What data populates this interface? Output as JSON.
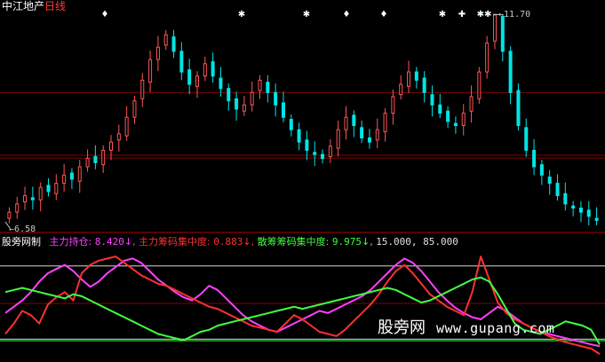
{
  "header": {
    "title": "中江地产",
    "period": "日线"
  },
  "price_panel": {
    "high_label": "11.70",
    "low_label": "6.58",
    "marker_glyphs": [
      "♦",
      "✱",
      "✱",
      "♦",
      "♦",
      "✱",
      "✚",
      "✱✱"
    ]
  },
  "indicator": {
    "name": "股旁网制",
    "items": [
      {
        "label": "主力持仓:",
        "value": "8.420",
        "arrow": "↓",
        "color": "#ff40ff"
      },
      {
        "label": "主力筹码集中度:",
        "value": "0.883",
        "arrow": "↓",
        "color": "#ff3030"
      },
      {
        "label": "散筹筹码集中度:",
        "value": "9.975",
        "arrow": "↓",
        "color": "#40ff40"
      }
    ],
    "levels": "15.000, 85.000"
  },
  "watermark": {
    "text": "股旁网",
    "url": "www.gupang.com"
  },
  "colors": {
    "background": "#000000",
    "up_candle": "#ff5555",
    "down_candle": "#00e5e5",
    "grid": "#8b0000",
    "magenta": "#ff40ff",
    "red": "#ff3030",
    "green": "#40ff40"
  },
  "chart_data": [
    {
      "type": "candlestick",
      "title": "中江地产 日线",
      "y_extremes": {
        "high": 11.7,
        "low": 6.58
      },
      "closes": [
        6.9,
        7.1,
        7.3,
        7.2,
        7.5,
        7.4,
        7.6,
        7.8,
        7.7,
        8.0,
        8.2,
        8.1,
        8.4,
        8.6,
        8.8,
        9.2,
        9.6,
        10.1,
        10.6,
        10.9,
        11.2,
        10.8,
        10.3,
        10.0,
        10.2,
        10.5,
        10.2,
        9.9,
        9.6,
        9.4,
        9.5,
        9.8,
        10.1,
        9.8,
        9.5,
        9.2,
        8.9,
        8.6,
        8.4,
        8.3,
        8.2,
        8.5,
        8.9,
        9.2,
        9.0,
        8.7,
        8.6,
        8.9,
        9.3,
        9.7,
        10.0,
        10.3,
        10.1,
        9.8,
        9.5,
        9.3,
        9.1,
        9.0,
        9.3,
        9.7,
        10.3,
        11.0,
        11.7,
        10.8,
        9.8,
        9.0,
        8.4,
        8.0,
        7.8,
        7.6,
        7.3,
        7.1,
        7.0,
        6.9,
        6.8,
        6.7
      ]
    },
    {
      "type": "line",
      "title": "股旁网制",
      "ylim": [
        0,
        100
      ],
      "reference_levels": [
        15,
        85
      ],
      "series": [
        {
          "name": "主力持仓",
          "values": [
            40,
            46,
            52,
            60,
            70,
            78,
            82,
            86,
            80,
            72,
            65,
            70,
            78,
            84,
            90,
            92,
            88,
            80,
            72,
            66,
            60,
            55,
            52,
            58,
            66,
            62,
            54,
            46,
            38,
            32,
            28,
            24,
            22,
            26,
            30,
            34,
            38,
            42,
            40,
            44,
            48,
            52,
            56,
            62,
            70,
            78,
            86,
            92,
            88,
            80,
            70,
            60,
            52,
            45,
            40,
            36,
            34,
            40,
            46,
            42,
            36,
            30,
            26,
            22,
            20,
            18,
            16,
            14,
            12,
            10,
            8.42
          ]
        },
        {
          "name": "主力筹码集中度",
          "values": [
            20,
            30,
            42,
            38,
            30,
            48,
            55,
            60,
            52,
            78,
            86,
            90,
            92,
            94,
            88,
            82,
            76,
            72,
            68,
            66,
            62,
            58,
            54,
            50,
            46,
            44,
            40,
            36,
            32,
            28,
            26,
            24,
            22,
            30,
            38,
            34,
            28,
            22,
            20,
            18,
            24,
            32,
            40,
            48,
            58,
            70,
            80,
            86,
            78,
            68,
            58,
            52,
            46,
            42,
            38,
            60,
            94,
            72,
            50,
            40,
            34,
            30,
            26,
            22,
            18,
            15,
            12,
            10,
            8,
            6,
            0.883
          ]
        },
        {
          "name": "散筹筹码集中度",
          "values": [
            60,
            62,
            64,
            62,
            60,
            58,
            56,
            54,
            58,
            56,
            52,
            48,
            44,
            40,
            36,
            32,
            28,
            24,
            20,
            18,
            16,
            14,
            18,
            22,
            24,
            28,
            30,
            32,
            34,
            36,
            38,
            40,
            42,
            44,
            46,
            44,
            46,
            48,
            50,
            52,
            54,
            56,
            58,
            60,
            62,
            64,
            62,
            58,
            54,
            50,
            52,
            56,
            60,
            64,
            68,
            72,
            74,
            70,
            58,
            44,
            30,
            24,
            22,
            20,
            24,
            28,
            32,
            30,
            28,
            24,
            9.975
          ]
        }
      ]
    }
  ]
}
